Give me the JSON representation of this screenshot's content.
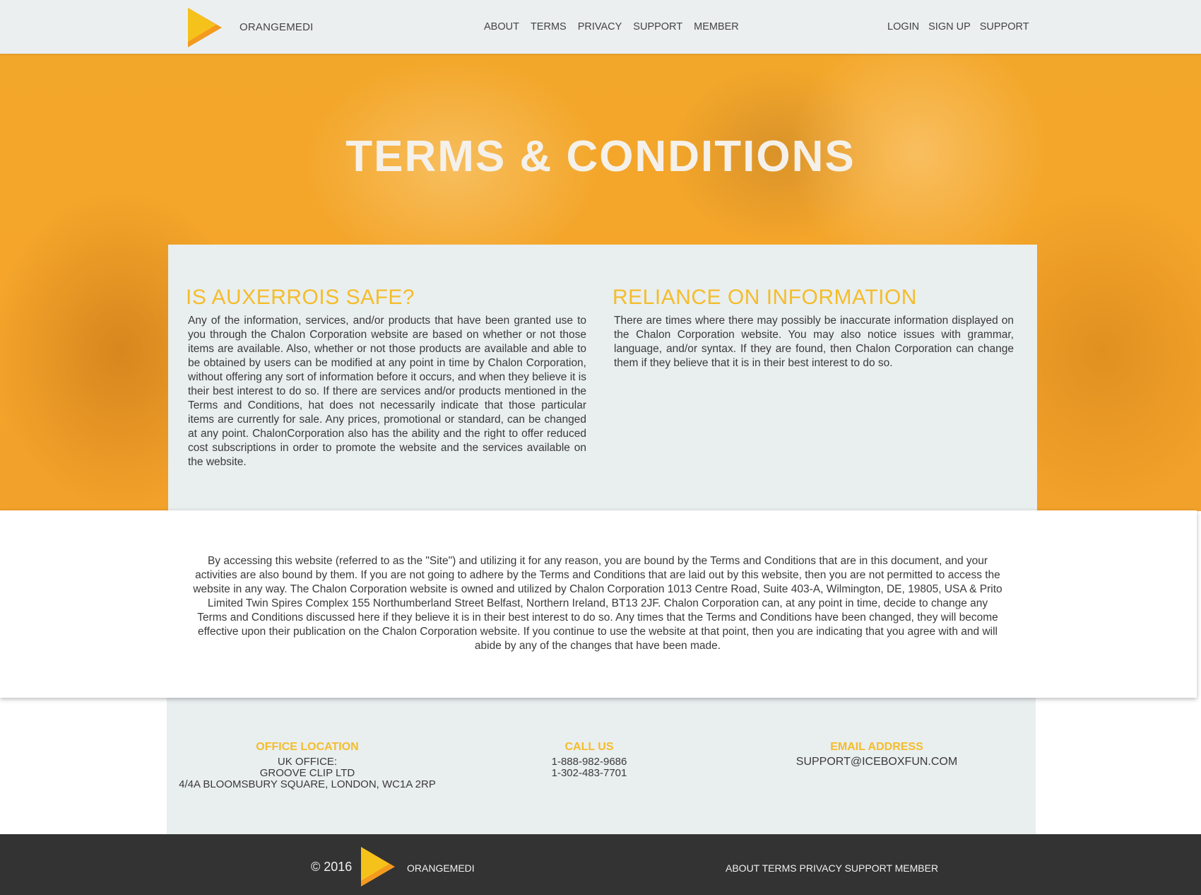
{
  "header": {
    "brand": "ORANGEMEDI",
    "nav_center": [
      "ABOUT",
      "TERMS",
      "PRIVACY",
      "SUPPORT",
      "MEMBER"
    ],
    "nav_right": [
      "LOGIN",
      "SIGN UP",
      "SUPPORT"
    ]
  },
  "hero": {
    "title": "TERMS & CONDITIONS"
  },
  "sections": {
    "left": {
      "heading": "IS AUXERROIS SAFE?",
      "body": "Any of the information, services, and/or products that have been granted use to you through the Chalon Corporation website are based on whether or not those items are available. Also, whether or not those products are available and able to be obtained by users can be modified at any point in time by Chalon Corporation, without offering any sort of information before it occurs, and when they believe it is their best interest to do so. If there are services and/or products mentioned in the Terms and Conditions, hat does not necessarily indicate that those particular items are currently for sale. Any prices, promotional or standard, can be changed at any point. ChalonCorporation also has the ability and the right to offer reduced cost subscriptions in order to promote the website and the services available on the website."
    },
    "right": {
      "heading": "RELIANCE ON INFORMATION",
      "body": "There are times where there may possibly be inaccurate information displayed on the Chalon Corporation website. You may also notice issues with grammar, language, and/or syntax. If they are found, then Chalon Corporation can change them if they believe that it is in their best interest to do so."
    }
  },
  "intro": {
    "body": "By accessing this website (referred to as the \"Site\") and utilizing it for any reason, you are bound by the Terms and Conditions that are in this document, and your activities are also bound by them. If you are not going to adhere by the Terms and Conditions that are laid out by this website, then you are not permitted to access the website in any way. The Chalon Corporation website is owned and utilized by Chalon Corporation 1013 Centre Road, Suite 403-A, Wilmington, DE, 19805, USA & Prito Limited Twin Spires Complex 155 Northumberland Street Belfast, Northern Ireland, BT13 2JF. Chalon Corporation can, at any point in time, decide to change any Terms and Conditions discussed here if they believe it is in their best interest to do so. Any times that the Terms and Conditions have been changed, they will become effective upon their publication on the Chalon Corporation website. If you continue to use the website at that point, then you are indicating that you agree with and will abide by any of the changes that have been made."
  },
  "contact": {
    "office": {
      "heading": "OFFICE LOCATION",
      "lines": [
        "UK OFFICE:",
        "GROOVE CLIP LTD",
        "4/4A BLOOMSBURY SQUARE, LONDON, WC1A 2RP"
      ]
    },
    "call": {
      "heading": "CALL US",
      "lines": [
        "1-888-982-9686",
        "1-302-483-7701"
      ]
    },
    "email": {
      "heading": "EMAIL ADDRESS",
      "address": "SUPPORT@ICEBOXFUN.COM"
    }
  },
  "footer": {
    "copyright": "© 2016",
    "brand": "ORANGEMEDI",
    "nav": [
      "ABOUT",
      "TERMS",
      "PRIVACY",
      "SUPPORT",
      "MEMBER"
    ]
  },
  "colors": {
    "accent": "#f4bd2a",
    "hero": "#f3a72a",
    "panel": "#e9eeef",
    "footer": "#333333"
  },
  "icons": {
    "logo": "orange-play-triangle-logo"
  }
}
